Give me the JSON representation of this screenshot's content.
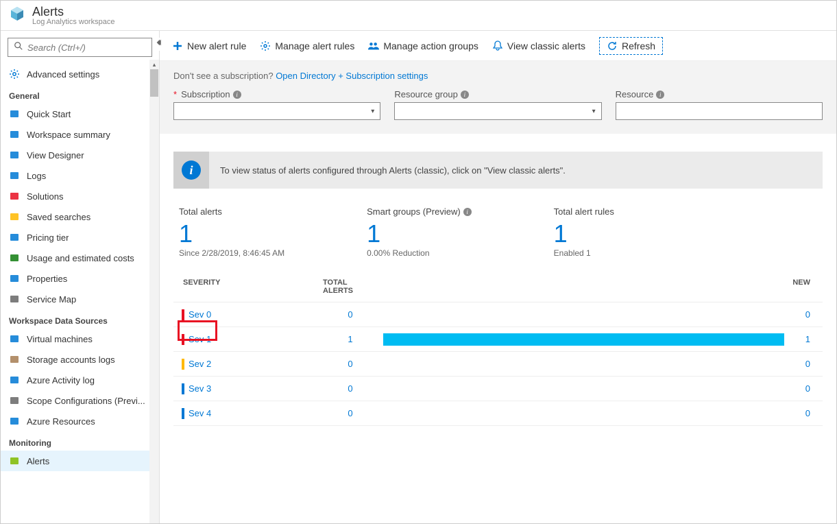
{
  "header": {
    "title": "Alerts",
    "subtitle": "Log Analytics workspace"
  },
  "search": {
    "placeholder": "Search (Ctrl+/)"
  },
  "sidebar": {
    "top": {
      "label": "Advanced settings"
    },
    "sections": [
      {
        "title": "General",
        "items": [
          {
            "label": "Quick Start",
            "icon_color": "#0078d4"
          },
          {
            "label": "Workspace summary",
            "icon_color": "#0078d4"
          },
          {
            "label": "View Designer",
            "icon_color": "#0078d4"
          },
          {
            "label": "Logs",
            "icon_color": "#0078d4"
          },
          {
            "label": "Solutions",
            "icon_color": "#e81123"
          },
          {
            "label": "Saved searches",
            "icon_color": "#ffb900"
          },
          {
            "label": "Pricing tier",
            "icon_color": "#0078d4"
          },
          {
            "label": "Usage and estimated costs",
            "icon_color": "#107c10"
          },
          {
            "label": "Properties",
            "icon_color": "#0078d4"
          },
          {
            "label": "Service Map",
            "icon_color": "#666"
          }
        ]
      },
      {
        "title": "Workspace Data Sources",
        "items": [
          {
            "label": "Virtual machines",
            "icon_color": "#0078d4"
          },
          {
            "label": "Storage accounts logs",
            "icon_color": "#a67c52"
          },
          {
            "label": "Azure Activity log",
            "icon_color": "#0078d4"
          },
          {
            "label": "Scope Configurations (Previ...",
            "icon_color": "#666"
          },
          {
            "label": "Azure Resources",
            "icon_color": "#0078d4"
          }
        ]
      },
      {
        "title": "Monitoring",
        "items": [
          {
            "label": "Alerts",
            "icon_color": "#7fba00",
            "active": true
          }
        ]
      }
    ]
  },
  "toolbar": {
    "new_rule": "New alert rule",
    "manage_rules": "Manage alert rules",
    "action_groups": "Manage action groups",
    "classic": "View classic alerts",
    "refresh": "Refresh"
  },
  "filters": {
    "hint_prefix": "Don't see a subscription? ",
    "hint_link": "Open Directory + Subscription settings",
    "subscription": "Subscription",
    "resource_group": "Resource group",
    "resource": "Resource"
  },
  "banner": "To view status of alerts configured through Alerts (classic), click on \"View classic alerts\".",
  "stats": {
    "total_title": "Total alerts",
    "total_num": "1",
    "total_sub": "Since 2/28/2019, 8:46:45 AM",
    "smart_title": "Smart groups (Preview)",
    "smart_num": "1",
    "smart_sub": "0.00% Reduction",
    "rules_title": "Total alert rules",
    "rules_num": "1",
    "rules_sub": "Enabled 1"
  },
  "table": {
    "head_severity": "SEVERITY",
    "head_total": "TOTAL ALERTS",
    "head_new": "NEW",
    "rows": [
      {
        "name": "Sev 0",
        "color": "#e81123",
        "total": "0",
        "new": "0",
        "barpct": 0
      },
      {
        "name": "Sev 1",
        "color": "#e81123",
        "total": "1",
        "new": "1",
        "barpct": 100,
        "highlight": true
      },
      {
        "name": "Sev 2",
        "color": "#ffb900",
        "total": "0",
        "new": "0",
        "barpct": 0
      },
      {
        "name": "Sev 3",
        "color": "#0078d4",
        "total": "0",
        "new": "0",
        "barpct": 0
      },
      {
        "name": "Sev 4",
        "color": "#0078d4",
        "total": "0",
        "new": "0",
        "barpct": 0
      }
    ]
  }
}
